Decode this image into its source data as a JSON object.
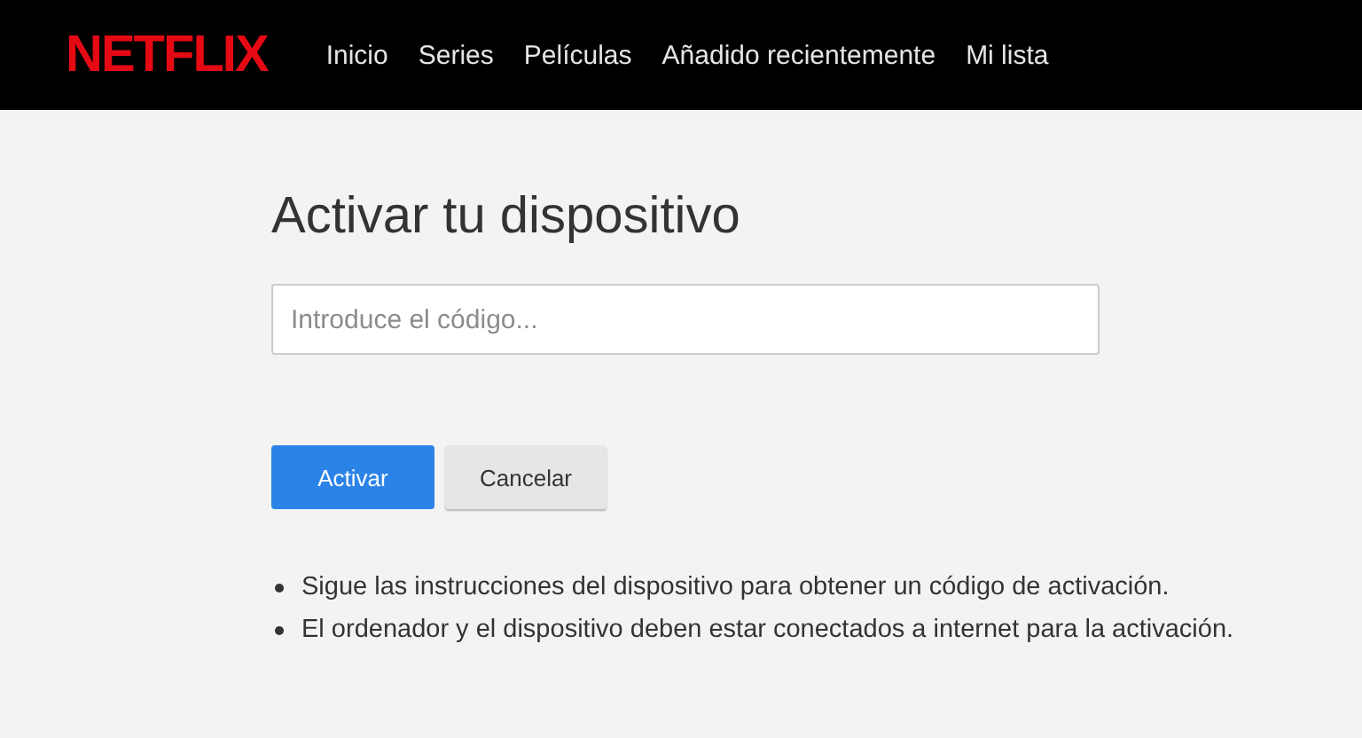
{
  "header": {
    "logo": "NETFLIX",
    "nav": [
      {
        "label": "Inicio"
      },
      {
        "label": "Series"
      },
      {
        "label": "Películas"
      },
      {
        "label": "Añadido recientemente"
      },
      {
        "label": "Mi lista"
      }
    ]
  },
  "title": "Activar tu dispositivo",
  "code_field": {
    "placeholder": "Introduce el código..."
  },
  "buttons": [
    {
      "label": "Activar",
      "kind": "primary"
    },
    {
      "label": "Cancelar",
      "kind": "secondary"
    }
  ],
  "notes": [
    "Sigue las instrucciones del dispositivo para obtener un código de activación.",
    "El ordenador y el dispositivo deben estar conectados a internet para la activación."
  ]
}
